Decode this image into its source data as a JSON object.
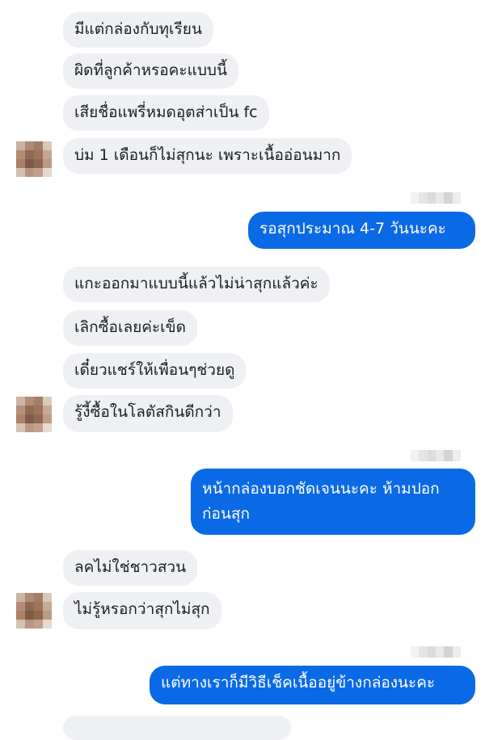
{
  "conversation": {
    "group1": {
      "m1": "มีแต่กล่องกับทุเรียน",
      "m2": "ผิดที่ลูกค้าหรอคะแบบนี้",
      "m3": "เสียชื่อแพรี่หมดอุตส่าเป็น fc",
      "m4": "บ่ม 1 เดือนก็ไม่สุกนะ เพราะเนื้ออ่อนมาก"
    },
    "reply1": "รอสุกประมาณ 4-7 วันนะคะ",
    "group2": {
      "m1": "แกะออกมาแบบนี้แล้วไม่น่าสุกแล้วค่ะ",
      "m2": "เลิกซื้อเลยค่ะเข็ด",
      "m3": "เดี๋ยวแชร์ให้เพื่อนๆช่วยดู",
      "m4": "รู้งี้ซื้อในโลตัสกินดีกว่า"
    },
    "reply2": "หน้ากล่องบอกชัดเจนนะคะ ห้ามปอกก่อนสุก",
    "group3": {
      "m1": "ลคไม่ใช่ชาวสวน",
      "m2": "ไม่รู้หรอกว่าสุกไม่สุก"
    },
    "reply3": "แต่ทางเราก็มีวิธีเช็คเนื้ออยู่ข้างกล่องนะคะ"
  },
  "theme": {
    "incoming_bubble": "#eff0f3",
    "outgoing_bubble": "#0a6ae6",
    "avatar_icon": "blurred-profile-avatar",
    "read_receipt_icon": "blurred-read-receipt"
  }
}
